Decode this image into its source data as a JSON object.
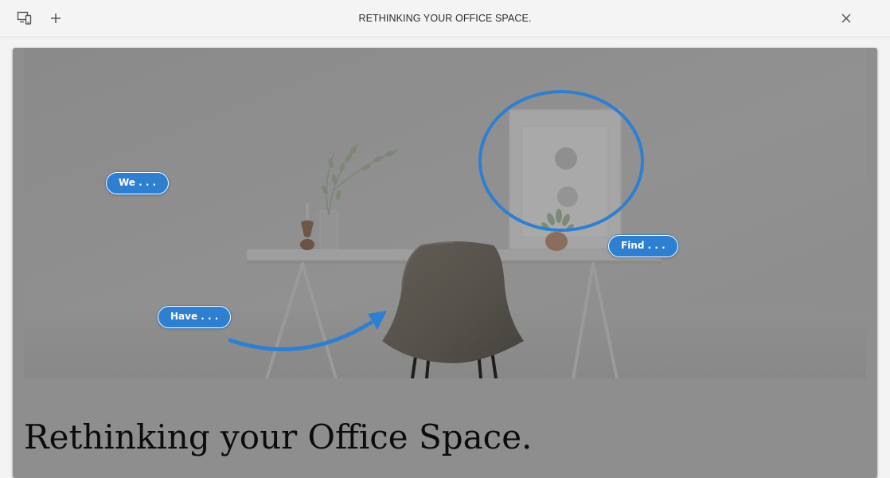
{
  "window": {
    "title": "RETHINKING YOUR OFFICE SPACE."
  },
  "toolbar": {
    "left_icons": [
      "device-preview-icon",
      "add-icon"
    ],
    "right_icons": [
      "close-icon"
    ]
  },
  "slide": {
    "heading": "Rethinking your Office Space.",
    "background_color": "#8e8e8e",
    "annotations": [
      {
        "label": "We . . ."
      },
      {
        "label": "Have . . ."
      },
      {
        "label": "Find . . ."
      }
    ],
    "marker_color": "#2f7fd1"
  }
}
